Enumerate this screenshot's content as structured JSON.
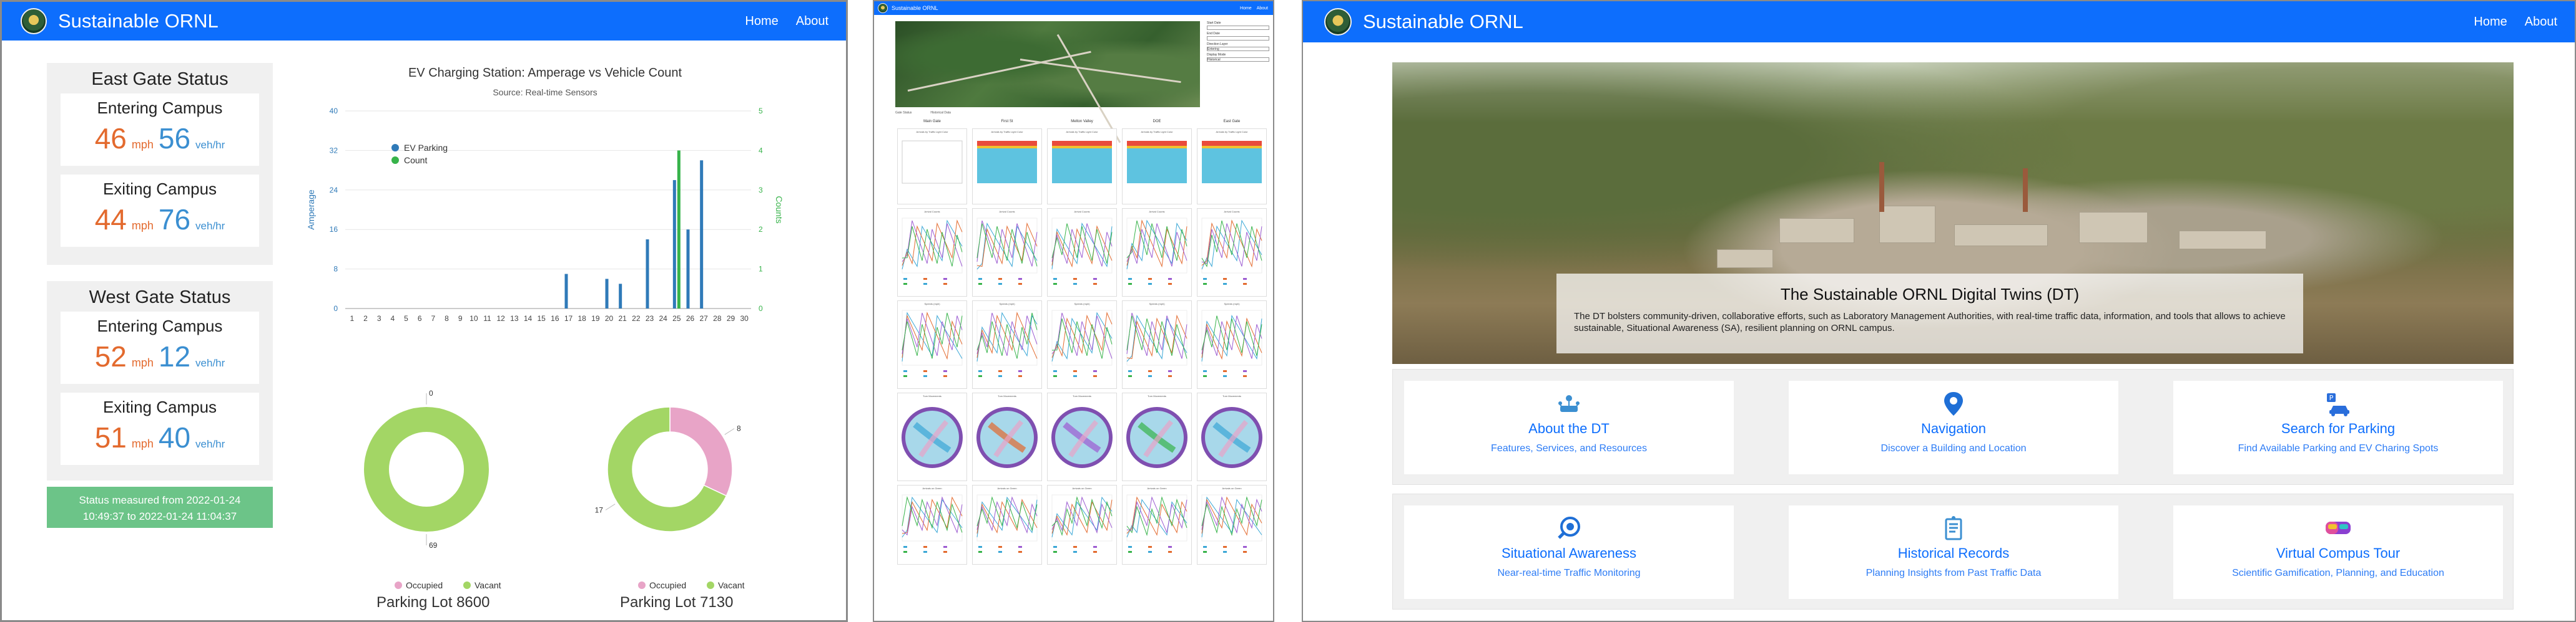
{
  "panel1": {
    "brand": "Sustainable ORNL",
    "nav": [
      "Home",
      "About"
    ],
    "east": {
      "title": "East Gate Status",
      "entering": {
        "label": "Entering Campus",
        "speed": "46",
        "speed_unit": "mph",
        "flow": "56",
        "flow_unit": "veh/hr"
      },
      "exiting": {
        "label": "Exiting Campus",
        "speed": "44",
        "speed_unit": "mph",
        "flow": "76",
        "flow_unit": "veh/hr"
      }
    },
    "west": {
      "title": "West Gate Status",
      "entering": {
        "label": "Entering Campus",
        "speed": "52",
        "speed_unit": "mph",
        "flow": "12",
        "flow_unit": "veh/hr"
      },
      "exiting": {
        "label": "Exiting Campus",
        "speed": "51",
        "speed_unit": "mph",
        "flow": "40",
        "flow_unit": "veh/hr"
      }
    },
    "status_line1": "Status measured from 2022-01-24",
    "status_line2": "10:49:37 to 2022-01-24 11:04:37",
    "lot1_name": "Parking Lot 8600",
    "lot2_name": "Parking Lot 7130"
  },
  "chart_data": [
    {
      "type": "bar",
      "title": "EV Charging Station: Amperage vs Vehicle Count",
      "subtitle": "Source: Real-time Sensors",
      "xlabel": "",
      "ylabel": "Amperage",
      "y2label": "Counts",
      "categories": [
        "1",
        "2",
        "3",
        "4",
        "5",
        "6",
        "7",
        "8",
        "9",
        "10",
        "11",
        "12",
        "13",
        "14",
        "15",
        "16",
        "17",
        "18",
        "19",
        "20",
        "21",
        "22",
        "23",
        "24",
        "25",
        "26",
        "27",
        "28",
        "29",
        "30"
      ],
      "ylim": [
        0,
        40
      ],
      "yticks": [
        0,
        8,
        16,
        24,
        32,
        40
      ],
      "y2lim": [
        0,
        5
      ],
      "y2ticks": [
        0,
        1,
        2,
        3,
        4,
        5
      ],
      "series": [
        {
          "name": "EV Parking",
          "axis": "left",
          "color": "#2f7ab8",
          "values": [
            0,
            0,
            0,
            0,
            0,
            0,
            0,
            0,
            0,
            0,
            0,
            0,
            0,
            0,
            0,
            0,
            7,
            0,
            0,
            6,
            5,
            0,
            14,
            0,
            26,
            16,
            30,
            0,
            0,
            0
          ]
        },
        {
          "name": "Count",
          "axis": "right",
          "color": "#37b34a",
          "values": [
            0,
            0,
            0,
            0,
            0,
            0,
            0,
            0,
            0,
            0,
            0,
            0,
            0,
            0,
            0,
            0,
            0,
            0,
            0,
            0,
            0,
            0,
            0,
            0,
            4,
            0,
            0,
            0,
            0,
            0
          ]
        }
      ],
      "legend": "top-left"
    },
    {
      "type": "pie",
      "title": "Parking Lot 8600",
      "labels": [
        "Occupied",
        "Vacant"
      ],
      "values": [
        0,
        69
      ],
      "colors": [
        "#e8a4c7",
        "#a3d665"
      ]
    },
    {
      "type": "pie",
      "title": "Parking Lot 7130",
      "labels": [
        "Occupied",
        "Vacant"
      ],
      "values": [
        8,
        17
      ],
      "colors": [
        "#e8a4c7",
        "#a3d665"
      ]
    }
  ],
  "panel2": {
    "brand": "Sustainable ORNL",
    "nav": [
      "Home",
      "About"
    ],
    "controls": [
      "Start Date",
      "End Date",
      "Direction Layer",
      "Entering",
      "Display Mode",
      "Historical"
    ],
    "tabs": [
      "Gate Status",
      "Historical Data"
    ],
    "columns": [
      "Main Gate",
      "First St",
      "Melton Valley",
      "DOE",
      "East Gate"
    ],
    "chart_titles": [
      "Arrivals by Traffic Light Color",
      "Arrival Counts",
      "Speeds (mph)",
      "Turn Movements",
      "Arrivals on Green"
    ]
  },
  "panel3": {
    "brand": "Sustainable ORNL",
    "nav": [
      "Home",
      "About"
    ],
    "hero_title": "The Sustainable ORNL Digital Twins (DT)",
    "hero_text": "The DT bolsters community-driven, collaborative efforts, such as Laboratory Management Authorities, with real-time traffic data, information, and tools that allows to achieve sustainable, Situational Awareness (SA), resilient planning on ORNL campus.",
    "tiles": [
      {
        "title": "About the DT",
        "subtitle": "Features, Services, and Resources",
        "icon": "network-icon",
        "color": "#3b8fd1"
      },
      {
        "title": "Navigation",
        "subtitle": "Discover a Building and Location",
        "icon": "map-pin-icon",
        "color": "#1f6fd6"
      },
      {
        "title": "Search for Parking",
        "subtitle": "Find Available Parking and EV Charing Spots",
        "icon": "parking-icon",
        "color": "#2a6edb"
      },
      {
        "title": "Situational Awareness",
        "subtitle": "Near-real-time Traffic Monitoring",
        "icon": "awareness-icon",
        "color": "#1f6fd6"
      },
      {
        "title": "Historical Records",
        "subtitle": "Planning Insights from Past Traffic Data",
        "icon": "records-icon",
        "color": "#3b8fd1"
      },
      {
        "title": "Virtual Compus Tour",
        "subtitle": "Scientific Gamification, Planning, and Education",
        "icon": "vr-headset-icon",
        "color": "#8a3fd1"
      }
    ]
  }
}
